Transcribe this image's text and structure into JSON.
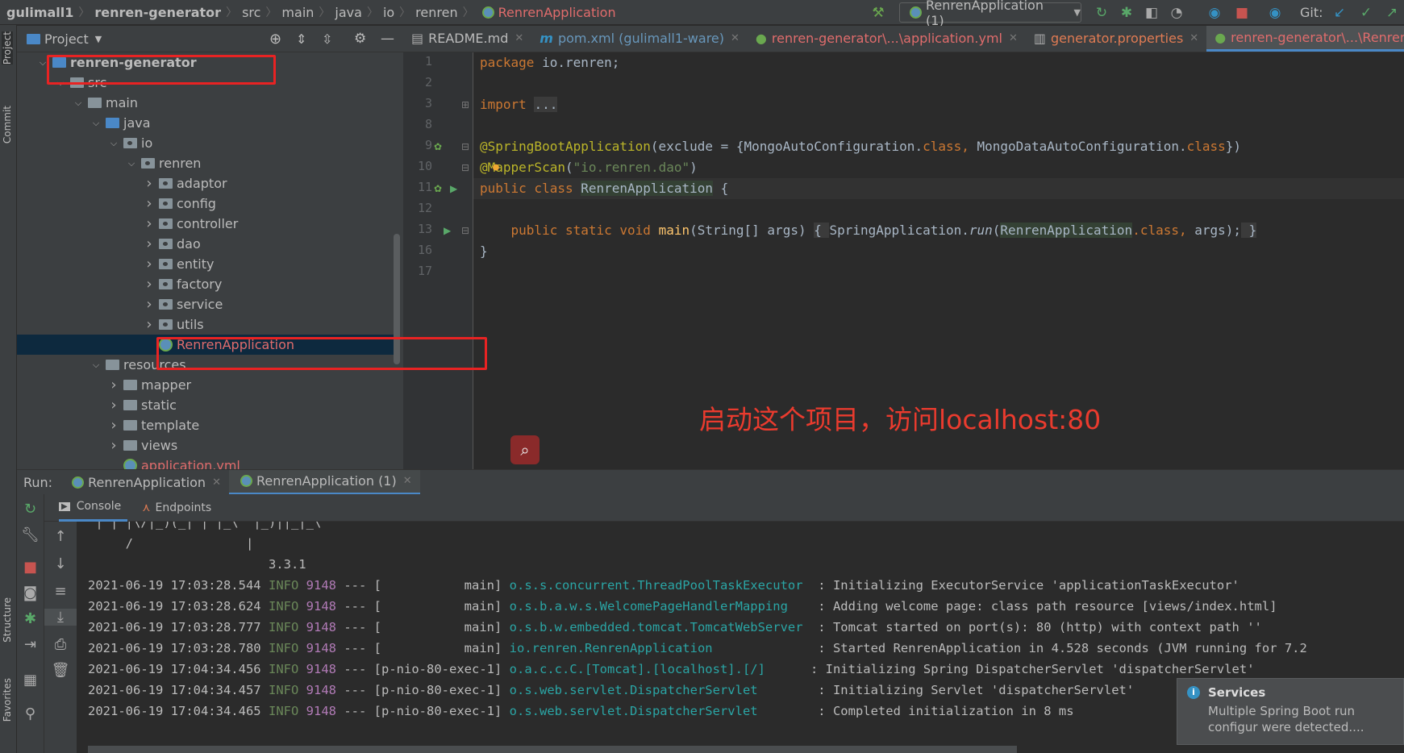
{
  "breadcrumb": [
    "gulimall1",
    "renren-generator",
    "src",
    "main",
    "java",
    "io",
    "renren",
    "RenrenApplication"
  ],
  "toolbar": {
    "run_config": "RenrenApplication (1)",
    "git_label": "Git:"
  },
  "side_strip": {
    "project": "Project",
    "commit": "Commit",
    "structure": "Structure",
    "favorites": "Favorites"
  },
  "project_panel": {
    "title": "Project"
  },
  "tree": [
    {
      "label": "renren-generator",
      "depth": 0,
      "arrow": "down",
      "icon": "module",
      "bold": true
    },
    {
      "label": "src",
      "depth": 1,
      "arrow": "down",
      "icon": "folder"
    },
    {
      "label": "main",
      "depth": 2,
      "arrow": "down",
      "icon": "folder"
    },
    {
      "label": "java",
      "depth": 3,
      "arrow": "down",
      "icon": "source-folder"
    },
    {
      "label": "io",
      "depth": 4,
      "arrow": "down",
      "icon": "package"
    },
    {
      "label": "renren",
      "depth": 5,
      "arrow": "down",
      "icon": "package"
    },
    {
      "label": "adaptor",
      "depth": 6,
      "arrow": "right",
      "icon": "package"
    },
    {
      "label": "config",
      "depth": 6,
      "arrow": "right",
      "icon": "package"
    },
    {
      "label": "controller",
      "depth": 6,
      "arrow": "right",
      "icon": "package"
    },
    {
      "label": "dao",
      "depth": 6,
      "arrow": "right",
      "icon": "package"
    },
    {
      "label": "entity",
      "depth": 6,
      "arrow": "right",
      "icon": "package"
    },
    {
      "label": "factory",
      "depth": 6,
      "arrow": "right",
      "icon": "package"
    },
    {
      "label": "service",
      "depth": 6,
      "arrow": "right",
      "icon": "package"
    },
    {
      "label": "utils",
      "depth": 6,
      "arrow": "right",
      "icon": "package"
    },
    {
      "label": "RenrenApplication",
      "depth": 6,
      "arrow": "none",
      "icon": "spring-class",
      "selected": true
    },
    {
      "label": "resources",
      "depth": 3,
      "arrow": "down",
      "icon": "folder"
    },
    {
      "label": "mapper",
      "depth": 4,
      "arrow": "right",
      "icon": "folder"
    },
    {
      "label": "static",
      "depth": 4,
      "arrow": "right",
      "icon": "folder"
    },
    {
      "label": "template",
      "depth": 4,
      "arrow": "right",
      "icon": "folder"
    },
    {
      "label": "views",
      "depth": 4,
      "arrow": "right",
      "icon": "folder"
    },
    {
      "label": "application.yml",
      "depth": 4,
      "arrow": "none",
      "icon": "spring-yml",
      "red": true
    }
  ],
  "editor_tabs": [
    {
      "label": "README.md",
      "style": "normal",
      "icon": "md-icon"
    },
    {
      "label": "pom.xml (gulimall1-ware)",
      "style": "blue",
      "icon": "maven-icon"
    },
    {
      "label": "renren-generator\\...\\application.yml",
      "style": "red",
      "icon": "spring-icon"
    },
    {
      "label": "generator.properties",
      "style": "orange",
      "icon": "properties-icon"
    },
    {
      "label": "renren-generator\\...\\RenrenApplication",
      "style": "red",
      "icon": "spring-class-icon",
      "active": true
    }
  ],
  "code": [
    {
      "n": "1",
      "t": [
        [
          "package ",
          "kw"
        ],
        [
          "io.renren;",
          "pl"
        ]
      ]
    },
    {
      "n": "2",
      "t": []
    },
    {
      "n": "3",
      "t": [
        [
          "import ",
          "kw"
        ],
        [
          "...",
          "dim"
        ]
      ]
    },
    {
      "n": "8",
      "t": []
    },
    {
      "n": "9",
      "t": [
        [
          "@SpringBootApplication",
          "ann"
        ],
        [
          "(exclude = {MongoAutoConfiguration.",
          "pl"
        ],
        [
          "class",
          "kw"
        ],
        [
          ", ",
          "kw"
        ],
        [
          "MongoDataAutoConfiguration.",
          "pl"
        ],
        [
          "class",
          "kw"
        ],
        [
          "})",
          "pl"
        ]
      ]
    },
    {
      "n": "10",
      "t": [
        [
          "@MapperScan",
          "ann"
        ],
        [
          "(",
          "pl"
        ],
        [
          "\"io.renren.dao\"",
          "str"
        ],
        [
          ")",
          "pl"
        ]
      ]
    },
    {
      "n": "11",
      "t": [
        [
          "public class ",
          "kw"
        ],
        [
          "RenrenApplication",
          "cls"
        ],
        [
          " {",
          "pl"
        ]
      ],
      "current": true
    },
    {
      "n": "12",
      "t": []
    },
    {
      "n": "13",
      "t": [
        [
          "    public static void ",
          "kw"
        ],
        [
          "main",
          "fn"
        ],
        [
          "(String[] args) ",
          "pl"
        ],
        [
          "{ ",
          "dim"
        ],
        [
          "SpringApplication.",
          "pl"
        ],
        [
          "run",
          "it"
        ],
        [
          "(",
          "pl"
        ],
        [
          "RenrenApplication",
          "hl"
        ],
        [
          ".class, ",
          "kw"
        ],
        [
          "args);",
          "pl"
        ],
        [
          " }",
          "dim"
        ]
      ]
    },
    {
      "n": "16",
      "t": [
        [
          "}",
          "pl"
        ]
      ]
    },
    {
      "n": "17",
      "t": []
    }
  ],
  "annotation_text": "启动这个项目，访问localhost:80",
  "run_panel": {
    "label": "Run:",
    "tabs": [
      {
        "label": "RenrenApplication"
      },
      {
        "label": "RenrenApplication (1)",
        "active": true
      }
    ],
    "subtabs": [
      "Console",
      "Endpoints"
    ]
  },
  "console": {
    "banner": [
      " | | |\\/|_)(_| | |_\\  |_)||_|_\\",
      "     /               |",
      "                        3.3.1"
    ],
    "lines": [
      [
        "2021-06-19 17:03:28.544",
        "INFO",
        "9148",
        "---",
        "[           main]",
        "o.s.s.concurrent.ThreadPoolTaskExecutor ",
        ": Initializing ExecutorService 'applicationTaskExecutor'"
      ],
      [
        "2021-06-19 17:03:28.624",
        "INFO",
        "9148",
        "---",
        "[           main]",
        "o.s.b.a.w.s.WelcomePageHandlerMapping   ",
        ": Adding welcome page: class path resource [views/index.html]"
      ],
      [
        "2021-06-19 17:03:28.777",
        "INFO",
        "9148",
        "---",
        "[           main]",
        "o.s.b.w.embedded.tomcat.TomcatWebServer ",
        ": Tomcat started on port(s): 80 (http) with context path ''"
      ],
      [
        "2021-06-19 17:03:28.780",
        "INFO",
        "9148",
        "---",
        "[           main]",
        "io.renren.RenrenApplication             ",
        ": Started RenrenApplication in 4.528 seconds (JVM running for 7.2"
      ],
      [
        "2021-06-19 17:04:34.456",
        "INFO",
        "9148",
        "---",
        "[p-nio-80-exec-1]",
        "o.a.c.c.C.[Tomcat].[localhost].[/]     ",
        ": Initializing Spring DispatcherServlet 'dispatcherServlet'"
      ],
      [
        "2021-06-19 17:04:34.457",
        "INFO",
        "9148",
        "---",
        "[p-nio-80-exec-1]",
        "o.s.web.servlet.DispatcherServlet       ",
        ": Initializing Servlet 'dispatcherServlet'"
      ],
      [
        "2021-06-19 17:04:34.465",
        "INFO",
        "9148",
        "---",
        "[p-nio-80-exec-1]",
        "o.s.web.servlet.DispatcherServlet       ",
        ": Completed initialization in 8 ms"
      ]
    ]
  },
  "notification": {
    "title": "Services",
    "body": "Multiple Spring Boot run configur were detected...."
  },
  "colors": {
    "highlight_box": "#e82323",
    "annotation": "#ea3b2e",
    "accent": "#4a88c7"
  }
}
